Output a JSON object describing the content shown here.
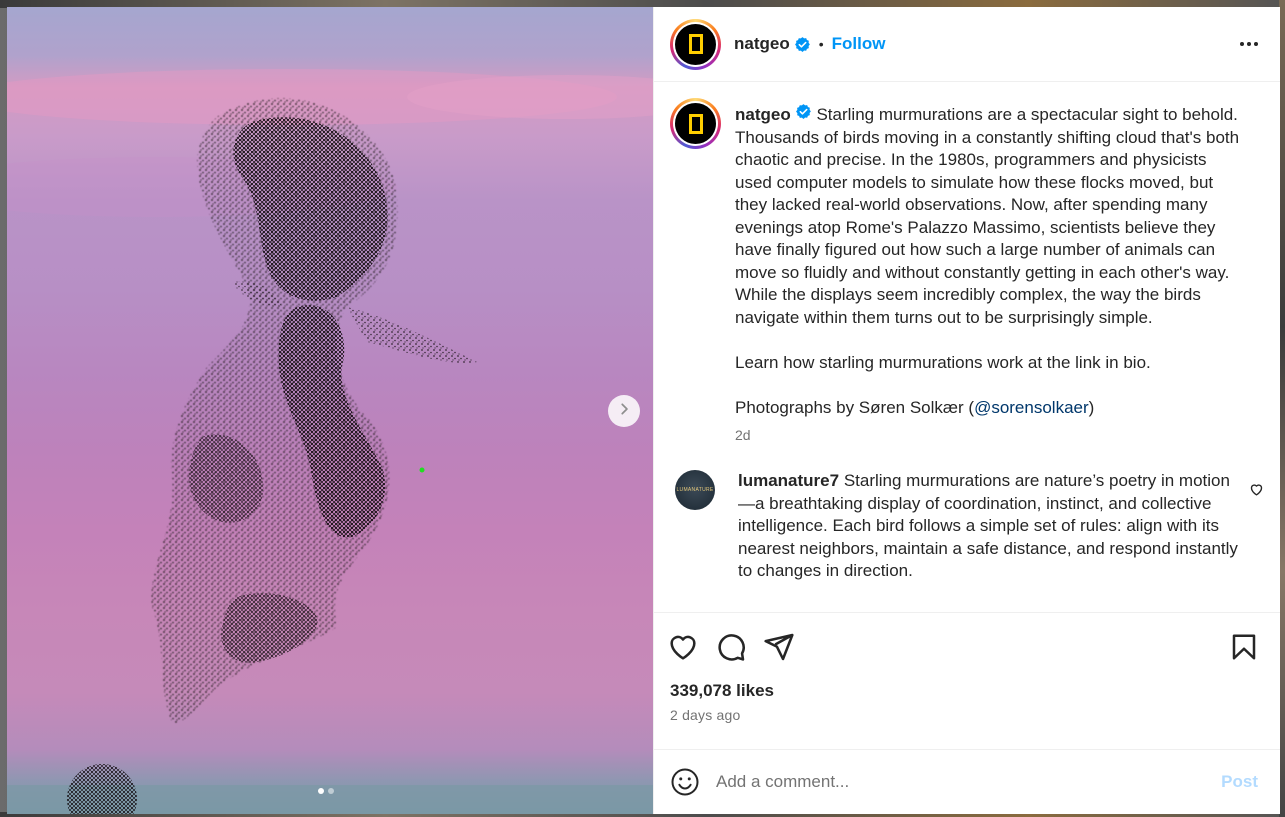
{
  "post": {
    "author": "natgeo",
    "follow_label": "Follow",
    "separator": "•",
    "caption_text": " Starling murmurations are a spectacular sight to behold. Thousands of birds moving in a constantly shifting cloud that's both chaotic and precise. In the 1980s, programmers and physicists used computer models to simulate how these flocks moved, but they lacked real-world observations. Now, after spending many evenings atop Rome's Palazzo Massimo, scientists believe they have finally figured out how such a large number of animals can move so fluidly and without constantly getting in each other's way. While the displays seem incredibly complex, the way the birds navigate within them turns out to be surprisingly simple.\n\nLearn how starling murmurations work at the link in bio.\n\nPhotographs by Søren Solkær (",
    "caption_mention": "@sorensolkaer",
    "caption_close": ")",
    "caption_age": "2d",
    "likes": "339,078 likes",
    "date": "2 days ago",
    "carousel": {
      "slide_count": 2,
      "active_index": 0
    }
  },
  "comments": [
    {
      "user": "lumanature7",
      "text": " Starling murmurations are nature’s poetry in motion—a breathtaking display of coordination, instinct, and collective intelligence. Each bird follows a simple set of rules: align with its nearest neighbors, maintain a safe distance, and respond instantly to changes in direction.",
      "avatar_text": "LUMANATURE"
    }
  ],
  "comment_box": {
    "placeholder": "Add a comment...",
    "value": "",
    "post_label": "Post"
  },
  "icons": {
    "more": "more-horizontal-icon",
    "like": "heart-icon",
    "comment": "comment-icon",
    "share": "paper-plane-icon",
    "save": "bookmark-icon",
    "emoji": "smiley-icon",
    "next": "chevron-right-icon",
    "verified": "verified-badge-icon"
  },
  "colors": {
    "accent": "#0095f6",
    "verified": "#0095f6",
    "mention": "#00376b",
    "post_disabled": "#b3dbff",
    "ng_yellow": "#ffce00"
  }
}
